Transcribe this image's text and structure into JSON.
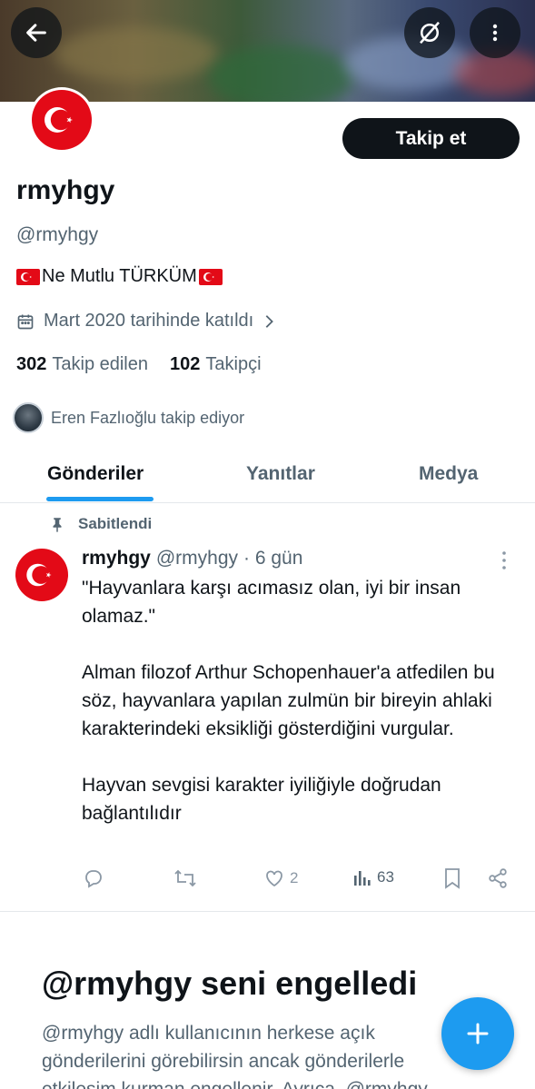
{
  "header": {
    "back_icon": "arrow-left-icon",
    "grok_icon": "grok-icon",
    "more_icon": "vertical-dots-icon"
  },
  "profile": {
    "follow_label": "Takip et",
    "name": "rmyhgy",
    "handle": "@rmyhgy",
    "bio": "Ne Mutlu TÜRKÜM",
    "joined": "Mart 2020 tarihinde katıldı",
    "following_count": "302",
    "following_label": "Takip edilen",
    "followers_count": "102",
    "followers_label": "Takipçi",
    "followed_by": "Eren Fazlıoğlu takip ediyor"
  },
  "tabs": [
    {
      "label": "Gönderiler",
      "active": true
    },
    {
      "label": "Yanıtlar",
      "active": false
    },
    {
      "label": "Medya",
      "active": false
    }
  ],
  "post": {
    "pinned_label": "Sabitlendi",
    "author_name": "rmyhgy",
    "author_handle": "@rmyhgy",
    "time": "· 6 gün",
    "text": "\"Hayvanlara karşı acımasız olan, iyi bir insan olamaz.\"\n\nAlman filozof Arthur Schopenhauer'a atfedilen bu söz, hayvanlara yapılan zulmün bir bireyin ahlaki karakterindeki eksikliği gösterdiğini vurgular.\n\nHayvan sevgisi karakter iyiliğiyle doğrudan bağlantılıdır",
    "likes": "2",
    "views": "63"
  },
  "blocked": {
    "title": "@rmyhgy seni engelledi",
    "text": "@rmyhgy adlı kullanıcının herkese açık gönderilerini görebilirsin ancak gönderilerle etkileşim kurman engellenir. Ayrıca, @rmyhgy"
  },
  "colors": {
    "accent": "#1d9bf0",
    "text": "#0f1419",
    "secondary": "#536471",
    "flag_red": "#e30a17"
  }
}
